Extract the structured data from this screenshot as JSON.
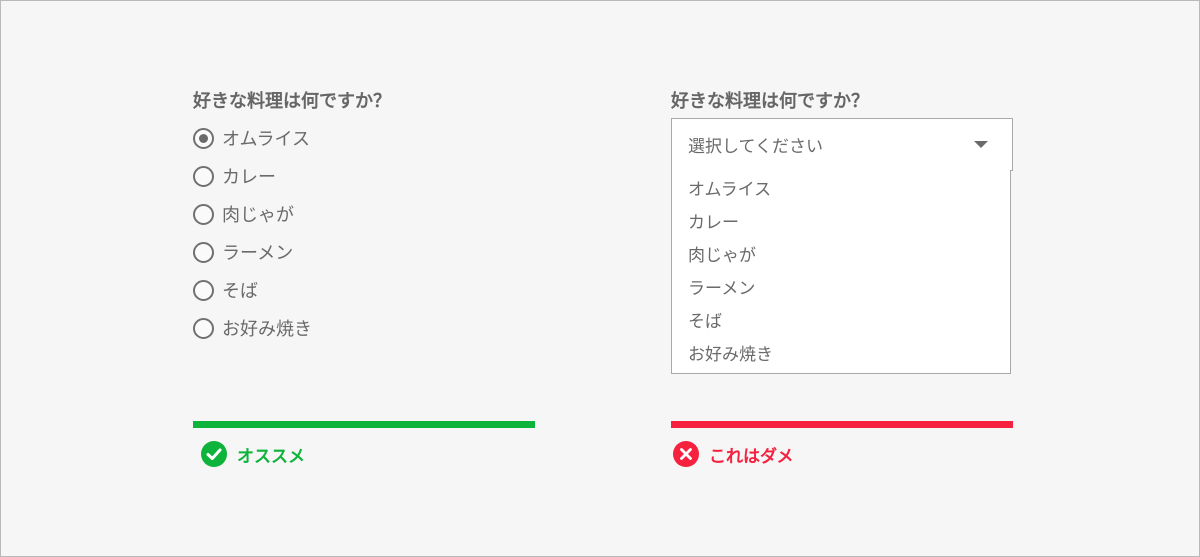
{
  "colors": {
    "good": "#0db33a",
    "bad": "#f5213e",
    "background": "#f6f6f6"
  },
  "left": {
    "question": "好きな料理は何ですか？",
    "selected_index": 0,
    "options": [
      "オムライス",
      "カレー",
      "肉じゃが",
      "ラーメン",
      "そば",
      "お好み焼き"
    ],
    "verdict": {
      "icon": "check-circle-icon",
      "label": "オススメ"
    }
  },
  "right": {
    "question": "好きな料理は何ですか？",
    "select": {
      "placeholder": "選択してください",
      "caret_icon": "caret-down-icon"
    },
    "options": [
      "オムライス",
      "カレー",
      "肉じゃが",
      "ラーメン",
      "そば",
      "お好み焼き"
    ],
    "verdict": {
      "icon": "x-circle-icon",
      "label": "これはダメ"
    }
  }
}
